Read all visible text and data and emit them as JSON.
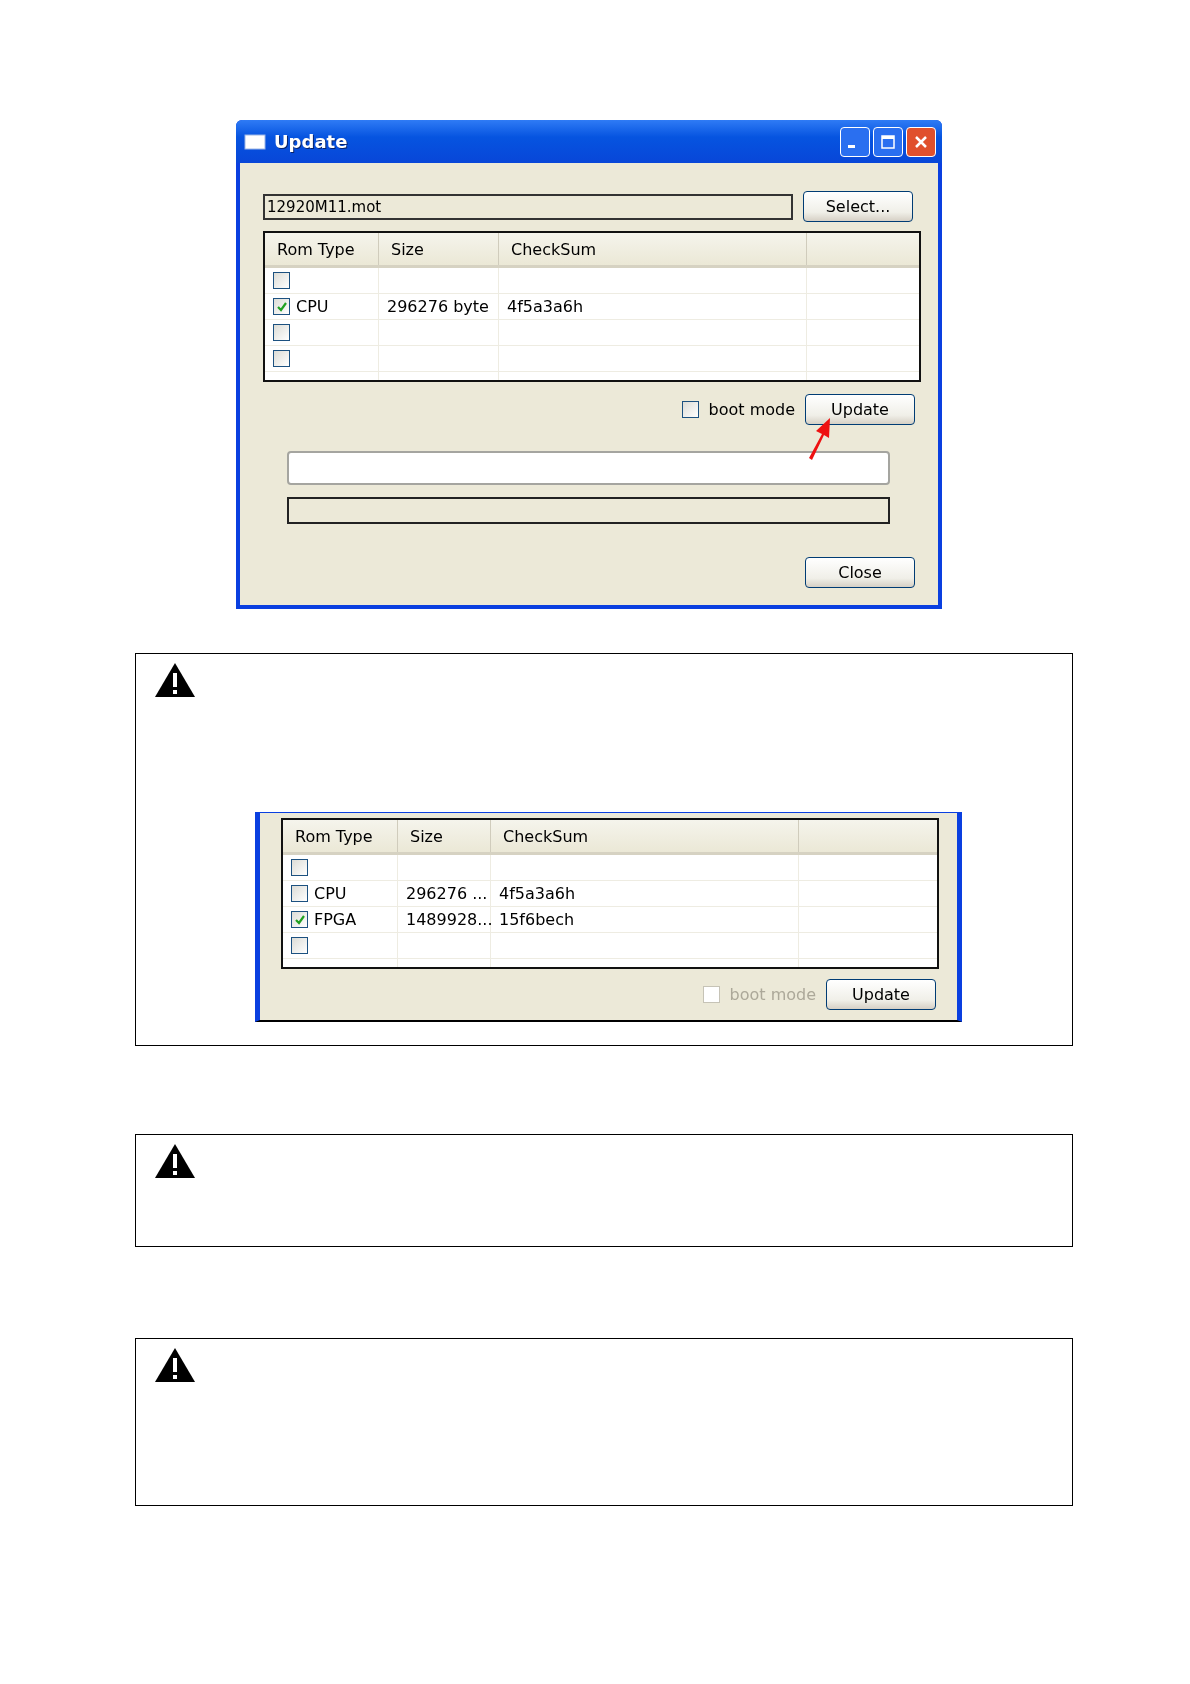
{
  "window": {
    "title": "Update",
    "file_field": {
      "value": "12920M11.mot"
    },
    "select_button": "Select...",
    "table": {
      "columns": [
        "Rom Type",
        "Size",
        "CheckSum"
      ],
      "rows": [
        {
          "checked": false,
          "rom_type": "",
          "size": "",
          "checksum": ""
        },
        {
          "checked": true,
          "rom_type": "CPU",
          "size": "296276 byte",
          "checksum": "4f5a3a6h"
        },
        {
          "checked": false,
          "rom_type": "",
          "size": "",
          "checksum": ""
        },
        {
          "checked": false,
          "rom_type": "",
          "size": "",
          "checksum": ""
        }
      ]
    },
    "boot_mode": {
      "label": "boot mode",
      "checked": false,
      "disabled": false
    },
    "update_button": "Update",
    "close_button": "Close"
  },
  "notes": [
    {
      "kind": "screenshot",
      "table": {
        "columns": [
          "Rom Type",
          "Size",
          "CheckSum"
        ],
        "rows": [
          {
            "checked": false,
            "rom_type": "",
            "size": "",
            "checksum": ""
          },
          {
            "checked": false,
            "rom_type": "CPU",
            "size": "296276 ...",
            "checksum": "4f5a3a6h"
          },
          {
            "checked": true,
            "rom_type": "FPGA",
            "size": "1489928...",
            "checksum": "15f6bech"
          },
          {
            "checked": false,
            "rom_type": "",
            "size": "",
            "checksum": ""
          }
        ]
      },
      "boot_mode": {
        "label": "boot mode",
        "checked": false,
        "disabled": true
      },
      "update_button": "Update"
    },
    {
      "kind": "short"
    },
    {
      "kind": "tall"
    }
  ]
}
